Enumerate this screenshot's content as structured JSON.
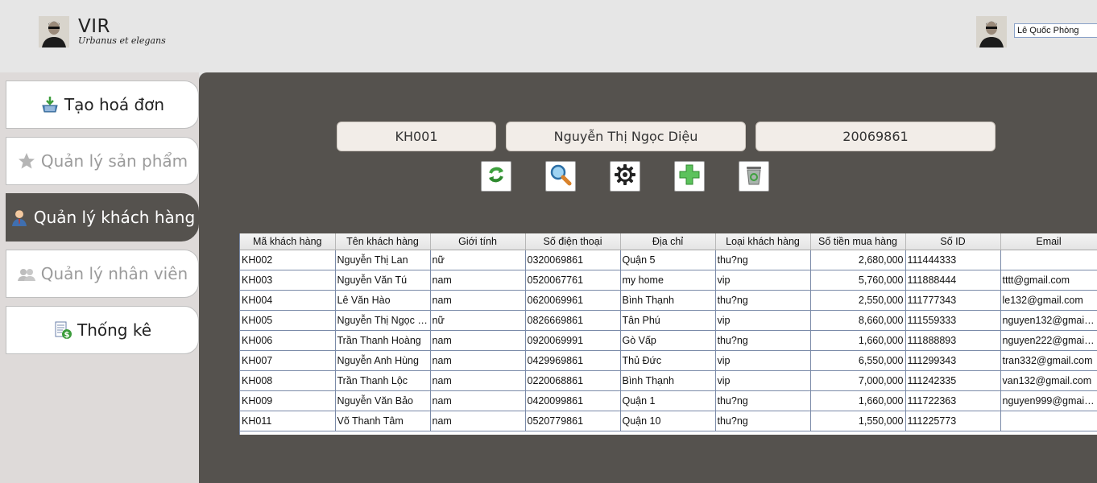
{
  "header": {
    "brand_title": "VIR",
    "brand_subtitle": "Urbanus et elegans",
    "user_name": "Lê Quốc Phòng"
  },
  "sidebar": {
    "items": [
      {
        "label": "Tạo hoá đơn",
        "icon": "basket-icon",
        "state": "normal"
      },
      {
        "label": "Quản lý sản phẩm",
        "icon": "star-icon",
        "state": "disabled"
      },
      {
        "label": "Quản lý khách hàng",
        "icon": "customer-icon",
        "state": "active"
      },
      {
        "label": "Quản lý nhân viên",
        "icon": "employees-icon",
        "state": "disabled"
      },
      {
        "label": "Thống kê",
        "icon": "report-icon",
        "state": "normal"
      }
    ]
  },
  "form": {
    "customer_id": "KH001",
    "customer_name": "Nguyễn Thị Ngọc Diệu",
    "phone_or_id": "20069861"
  },
  "toolbar": {
    "buttons": [
      "refresh-icon",
      "search-icon",
      "settings-icon",
      "add-icon",
      "delete-icon"
    ]
  },
  "table": {
    "headers": [
      "Mã khách hàng",
      "Tên khách hàng",
      "Giới tính",
      "Số điện thoại",
      "Địa chỉ",
      "Loại khách hàng",
      "Số tiền mua hàng",
      "Số ID",
      "Email"
    ],
    "rows": [
      [
        "KH002",
        "Nguyễn Thị Lan",
        "nữ",
        "0320069861",
        "Quận 5",
        "thu?ng",
        "2,680,000",
        "111444333",
        ""
      ],
      [
        "KH003",
        "Nguyễn Văn Tú",
        "nam",
        "0520067761",
        "my home",
        "vip",
        "5,760,000",
        "111888444",
        "tttt@gmail.com"
      ],
      [
        "KH004",
        "Lê Văn Hào",
        "nam",
        "0620069961",
        "Bình Thạnh",
        "thu?ng",
        "2,550,000",
        "111777343",
        "le132@gmail.com"
      ],
      [
        "KH005",
        "Nguyễn Thị Ngọc M...",
        "nữ",
        "0826669861",
        "Tân Phú",
        "vip",
        "8,660,000",
        "111559333",
        "nguyen132@gmail...."
      ],
      [
        "KH006",
        "Trần Thanh Hoàng",
        "nam",
        "0920069991",
        "Gò Vấp",
        "thu?ng",
        "1,660,000",
        "111888893",
        "nguyen222@gmail...."
      ],
      [
        "KH007",
        "Nguyễn Anh Hùng",
        "nam",
        "0429969861",
        "Thủ Đức",
        "vip",
        "6,550,000",
        "111299343",
        "tran332@gmail.com"
      ],
      [
        "KH008",
        "Trần Thanh Lộc",
        "nam",
        "0220068861",
        "Bình Thạnh",
        "vip",
        "7,000,000",
        "111242335",
        "van132@gmail.com"
      ],
      [
        "KH009",
        "Nguyễn Văn Bảo",
        "nam",
        "0420099861",
        "Quận 1",
        "thu?ng",
        "1,660,000",
        "111722363",
        "nguyen999@gmail...."
      ],
      [
        "KH011",
        "Võ Thanh Tâm",
        "nam",
        "0520779861",
        "Quận 10",
        "thu?ng",
        "1,550,000",
        "111225773",
        ""
      ]
    ]
  }
}
